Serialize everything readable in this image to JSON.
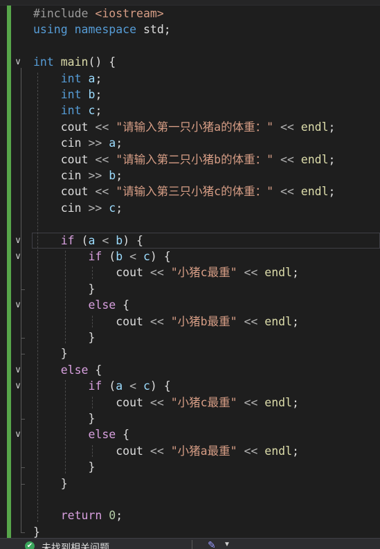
{
  "editor": {
    "lines": [
      {
        "fold": "",
        "tokens": [
          {
            "c": "k-pre",
            "t": "#include "
          },
          {
            "c": "k-inc",
            "t": "<iostream>"
          }
        ]
      },
      {
        "fold": "",
        "tokens": [
          {
            "c": "k-kw",
            "t": "using"
          },
          {
            "c": "",
            "t": " "
          },
          {
            "c": "k-kw",
            "t": "namespace"
          },
          {
            "c": "",
            "t": " std;"
          }
        ]
      },
      {
        "fold": "",
        "tokens": []
      },
      {
        "fold": "v",
        "tokens": [
          {
            "c": "k-kw",
            "t": "int"
          },
          {
            "c": "",
            "t": " "
          },
          {
            "c": "k-fn",
            "t": "main"
          },
          {
            "c": "",
            "t": "() {"
          }
        ]
      },
      {
        "fold": "",
        "tokens": [
          {
            "c": "",
            "t": "    "
          },
          {
            "c": "k-kw",
            "t": "int"
          },
          {
            "c": "",
            "t": " "
          },
          {
            "c": "k-var",
            "t": "a"
          },
          {
            "c": "",
            "t": ";"
          }
        ]
      },
      {
        "fold": "",
        "tokens": [
          {
            "c": "",
            "t": "    "
          },
          {
            "c": "k-kw",
            "t": "int"
          },
          {
            "c": "",
            "t": " "
          },
          {
            "c": "k-var",
            "t": "b"
          },
          {
            "c": "",
            "t": ";"
          }
        ]
      },
      {
        "fold": "",
        "tokens": [
          {
            "c": "",
            "t": "    "
          },
          {
            "c": "k-kw",
            "t": "int"
          },
          {
            "c": "",
            "t": " "
          },
          {
            "c": "k-var",
            "t": "c"
          },
          {
            "c": "",
            "t": ";"
          }
        ]
      },
      {
        "fold": "",
        "tokens": [
          {
            "c": "",
            "t": "    cout "
          },
          {
            "c": "k-op",
            "t": "<<"
          },
          {
            "c": "",
            "t": " "
          },
          {
            "c": "k-str",
            "t": "\"请输入第一只小猪a的体重：\""
          },
          {
            "c": "",
            "t": " "
          },
          {
            "c": "k-op",
            "t": "<<"
          },
          {
            "c": "",
            "t": " "
          },
          {
            "c": "k-fn",
            "t": "endl"
          },
          {
            "c": "",
            "t": ";"
          }
        ]
      },
      {
        "fold": "",
        "tokens": [
          {
            "c": "",
            "t": "    cin "
          },
          {
            "c": "k-op",
            "t": ">>"
          },
          {
            "c": "",
            "t": " "
          },
          {
            "c": "k-var",
            "t": "a"
          },
          {
            "c": "",
            "t": ";"
          }
        ]
      },
      {
        "fold": "",
        "tokens": [
          {
            "c": "",
            "t": "    cout "
          },
          {
            "c": "k-op",
            "t": "<<"
          },
          {
            "c": "",
            "t": " "
          },
          {
            "c": "k-str",
            "t": "\"请输入第二只小猪b的体重：\""
          },
          {
            "c": "",
            "t": " "
          },
          {
            "c": "k-op",
            "t": "<<"
          },
          {
            "c": "",
            "t": " "
          },
          {
            "c": "k-fn",
            "t": "endl"
          },
          {
            "c": "",
            "t": ";"
          }
        ]
      },
      {
        "fold": "",
        "tokens": [
          {
            "c": "",
            "t": "    cin "
          },
          {
            "c": "k-op",
            "t": ">>"
          },
          {
            "c": "",
            "t": " "
          },
          {
            "c": "k-var",
            "t": "b"
          },
          {
            "c": "",
            "t": ";"
          }
        ]
      },
      {
        "fold": "",
        "tokens": [
          {
            "c": "",
            "t": "    cout "
          },
          {
            "c": "k-op",
            "t": "<<"
          },
          {
            "c": "",
            "t": " "
          },
          {
            "c": "k-str",
            "t": "\"请输入第三只小猪c的体重：\""
          },
          {
            "c": "",
            "t": " "
          },
          {
            "c": "k-op",
            "t": "<<"
          },
          {
            "c": "",
            "t": " "
          },
          {
            "c": "k-fn",
            "t": "endl"
          },
          {
            "c": "",
            "t": ";"
          }
        ]
      },
      {
        "fold": "",
        "tokens": [
          {
            "c": "",
            "t": "    cin "
          },
          {
            "c": "k-op",
            "t": ">>"
          },
          {
            "c": "",
            "t": " "
          },
          {
            "c": "k-var",
            "t": "c"
          },
          {
            "c": "",
            "t": ";"
          }
        ]
      },
      {
        "fold": "",
        "tokens": []
      },
      {
        "fold": "v",
        "highlight": true,
        "tokens": [
          {
            "c": "",
            "t": "    "
          },
          {
            "c": "k-ctl",
            "t": "if"
          },
          {
            "c": "",
            "t": " ("
          },
          {
            "c": "k-var",
            "t": "a"
          },
          {
            "c": "",
            "t": " "
          },
          {
            "c": "k-op",
            "t": "<"
          },
          {
            "c": "",
            "t": " "
          },
          {
            "c": "k-var",
            "t": "b"
          },
          {
            "c": "",
            "t": ") {"
          }
        ]
      },
      {
        "fold": "v",
        "tokens": [
          {
            "c": "",
            "t": "        "
          },
          {
            "c": "k-ctl",
            "t": "if"
          },
          {
            "c": "",
            "t": " ("
          },
          {
            "c": "k-var",
            "t": "b"
          },
          {
            "c": "",
            "t": " "
          },
          {
            "c": "k-op",
            "t": "<"
          },
          {
            "c": "",
            "t": " "
          },
          {
            "c": "k-var",
            "t": "c"
          },
          {
            "c": "",
            "t": ") {"
          }
        ]
      },
      {
        "fold": "",
        "tokens": [
          {
            "c": "",
            "t": "            cout "
          },
          {
            "c": "k-op",
            "t": "<<"
          },
          {
            "c": "",
            "t": " "
          },
          {
            "c": "k-str",
            "t": "\"小猪c最重\""
          },
          {
            "c": "",
            "t": " "
          },
          {
            "c": "k-op",
            "t": "<<"
          },
          {
            "c": "",
            "t": " "
          },
          {
            "c": "k-fn",
            "t": "endl"
          },
          {
            "c": "",
            "t": ";"
          }
        ]
      },
      {
        "fold": "",
        "tokens": [
          {
            "c": "",
            "t": "        }"
          }
        ]
      },
      {
        "fold": "v",
        "tokens": [
          {
            "c": "",
            "t": "        "
          },
          {
            "c": "k-ctl",
            "t": "else"
          },
          {
            "c": "",
            "t": " {"
          }
        ]
      },
      {
        "fold": "",
        "tokens": [
          {
            "c": "",
            "t": "            cout "
          },
          {
            "c": "k-op",
            "t": "<<"
          },
          {
            "c": "",
            "t": " "
          },
          {
            "c": "k-str",
            "t": "\"小猪b最重\""
          },
          {
            "c": "",
            "t": " "
          },
          {
            "c": "k-op",
            "t": "<<"
          },
          {
            "c": "",
            "t": " "
          },
          {
            "c": "k-fn",
            "t": "endl"
          },
          {
            "c": "",
            "t": ";"
          }
        ]
      },
      {
        "fold": "",
        "tokens": [
          {
            "c": "",
            "t": "        }"
          }
        ]
      },
      {
        "fold": "",
        "tokens": [
          {
            "c": "",
            "t": "    }"
          }
        ]
      },
      {
        "fold": "v",
        "tokens": [
          {
            "c": "",
            "t": "    "
          },
          {
            "c": "k-ctl",
            "t": "else"
          },
          {
            "c": "",
            "t": " {"
          }
        ]
      },
      {
        "fold": "v",
        "tokens": [
          {
            "c": "",
            "t": "        "
          },
          {
            "c": "k-ctl",
            "t": "if"
          },
          {
            "c": "",
            "t": " ("
          },
          {
            "c": "k-var",
            "t": "a"
          },
          {
            "c": "",
            "t": " "
          },
          {
            "c": "k-op",
            "t": "<"
          },
          {
            "c": "",
            "t": " "
          },
          {
            "c": "k-var",
            "t": "c"
          },
          {
            "c": "",
            "t": ") {"
          }
        ]
      },
      {
        "fold": "",
        "tokens": [
          {
            "c": "",
            "t": "            cout "
          },
          {
            "c": "k-op",
            "t": "<<"
          },
          {
            "c": "",
            "t": " "
          },
          {
            "c": "k-str",
            "t": "\"小猪c最重\""
          },
          {
            "c": "",
            "t": " "
          },
          {
            "c": "k-op",
            "t": "<<"
          },
          {
            "c": "",
            "t": " "
          },
          {
            "c": "k-fn",
            "t": "endl"
          },
          {
            "c": "",
            "t": ";"
          }
        ]
      },
      {
        "fold": "",
        "tokens": [
          {
            "c": "",
            "t": "        }"
          }
        ]
      },
      {
        "fold": "v",
        "tokens": [
          {
            "c": "",
            "t": "        "
          },
          {
            "c": "k-ctl",
            "t": "else"
          },
          {
            "c": "",
            "t": " {"
          }
        ]
      },
      {
        "fold": "",
        "tokens": [
          {
            "c": "",
            "t": "            cout "
          },
          {
            "c": "k-op",
            "t": "<<"
          },
          {
            "c": "",
            "t": " "
          },
          {
            "c": "k-str",
            "t": "\"小猪a最重\""
          },
          {
            "c": "",
            "t": " "
          },
          {
            "c": "k-op",
            "t": "<<"
          },
          {
            "c": "",
            "t": " "
          },
          {
            "c": "k-fn",
            "t": "endl"
          },
          {
            "c": "",
            "t": ";"
          }
        ]
      },
      {
        "fold": "",
        "tokens": [
          {
            "c": "",
            "t": "        }"
          }
        ]
      },
      {
        "fold": "",
        "tokens": [
          {
            "c": "",
            "t": "    }"
          }
        ]
      },
      {
        "fold": "",
        "tokens": []
      },
      {
        "fold": "",
        "tokens": [
          {
            "c": "",
            "t": "    "
          },
          {
            "c": "k-ctl",
            "t": "return"
          },
          {
            "c": "",
            "t": " "
          },
          {
            "c": "k-num",
            "t": "0"
          },
          {
            "c": "",
            "t": ";"
          }
        ]
      },
      {
        "fold": "",
        "tokens": [
          {
            "c": "",
            "t": "}"
          }
        ]
      }
    ]
  },
  "status": {
    "icon": "check-circle-icon",
    "text": "未找到相关问题",
    "tool_icon": "paintbrush-icon"
  }
}
